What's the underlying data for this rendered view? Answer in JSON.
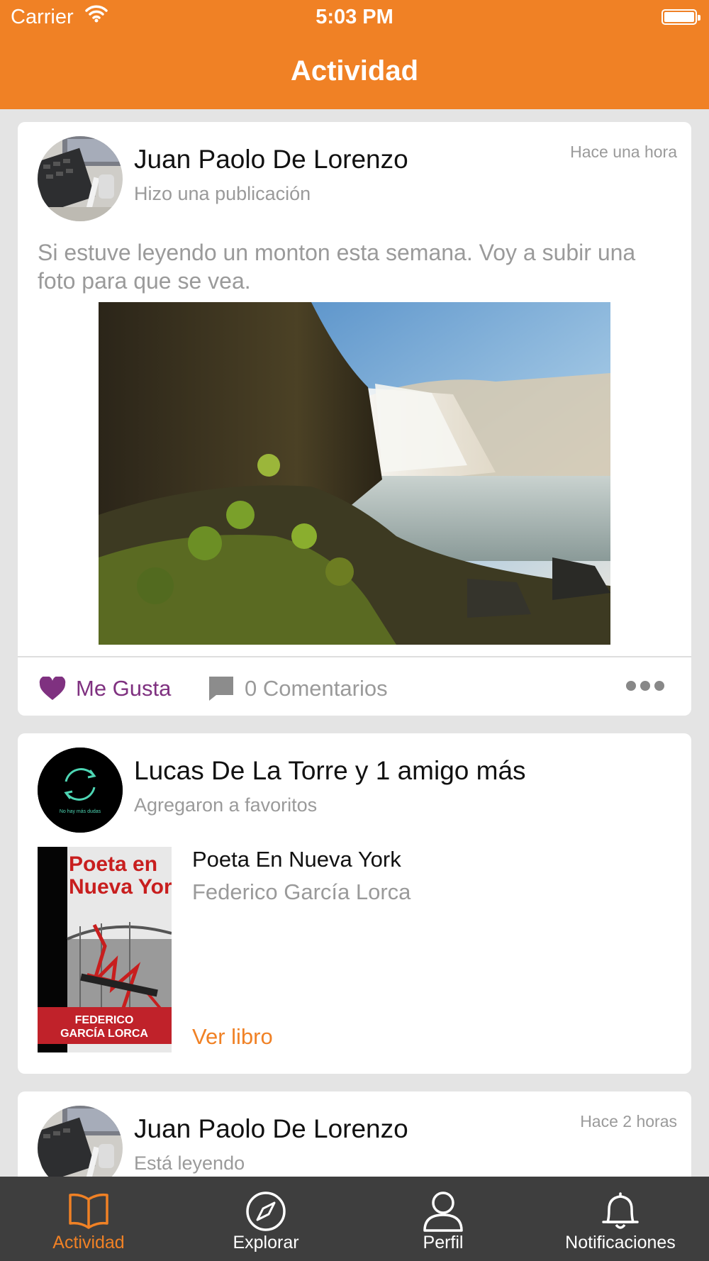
{
  "status_bar": {
    "carrier": "Carrier",
    "time": "5:03 PM"
  },
  "nav": {
    "title": "Actividad"
  },
  "feed": [
    {
      "user": "Juan Paolo De Lorenzo",
      "action": "Hizo una publicación",
      "time_ago": "Hace una hora",
      "text": "Si estuve leyendo un monton esta semana. Voy a subir una foto para que se vea.",
      "like_label": "Me Gusta",
      "comments_label": "0 Comentarios"
    },
    {
      "user": "Lucas De La Torre y 1 amigo más",
      "action": "Agregaron a favoritos",
      "avatar_caption": "No hay más dudas",
      "book_title": "Poeta En Nueva York",
      "book_author": "Federico García Lorca",
      "cover_title": "Poeta en Nueva York",
      "cover_author_line1": "FEDERICO",
      "cover_author_line2": "GARCÍA LORCA",
      "view_label": "Ver libro"
    },
    {
      "user": "Juan Paolo De Lorenzo",
      "action": "Está leyendo",
      "time_ago": "Hace 2 horas"
    }
  ],
  "tabs": [
    {
      "label": "Actividad",
      "icon": "book-icon",
      "active": true
    },
    {
      "label": "Explorar",
      "icon": "compass-icon",
      "active": false
    },
    {
      "label": "Perfil",
      "icon": "person-icon",
      "active": false
    },
    {
      "label": "Notificaciones",
      "icon": "bell-icon",
      "active": false
    }
  ],
  "colors": {
    "accent": "#f08125",
    "like": "#7f3180",
    "tab_bar": "#3e3e3e",
    "background": "#e4e4e4"
  }
}
